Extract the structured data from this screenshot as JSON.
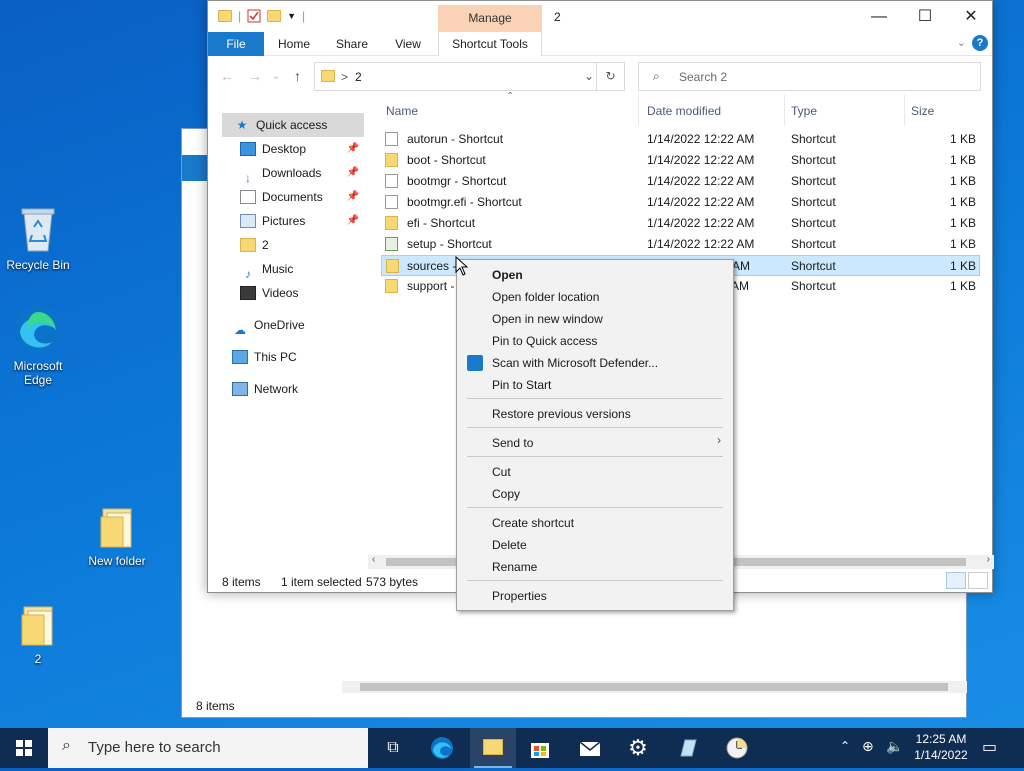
{
  "desktop": {
    "icons": [
      {
        "label": "Recycle Bin",
        "icon": "recycle-bin-icon"
      },
      {
        "label": "Microsoft Edge",
        "icon": "edge-icon"
      },
      {
        "label": "New folder",
        "icon": "folder-icon"
      },
      {
        "label": "2",
        "icon": "folder-icon"
      }
    ]
  },
  "background_window": {
    "status": "8 items"
  },
  "window": {
    "title": "2",
    "manage_tab": "Manage",
    "ribbon_tabs": [
      "File",
      "Home",
      "Share",
      "View",
      "Shortcut Tools"
    ],
    "address": {
      "separator": ">",
      "path": "2"
    },
    "search_placeholder": "Search 2",
    "controls": {
      "minimize": "—",
      "maximize": "☐",
      "close": "✕"
    },
    "help": "?"
  },
  "nav_pane": {
    "items": [
      {
        "label": "Quick access",
        "icon": "star-icon",
        "pinned": false
      },
      {
        "label": "Desktop",
        "icon": "desktop-icon",
        "pinned": true
      },
      {
        "label": "Downloads",
        "icon": "download-icon",
        "pinned": true
      },
      {
        "label": "Documents",
        "icon": "documents-icon",
        "pinned": true
      },
      {
        "label": "Pictures",
        "icon": "pictures-icon",
        "pinned": true
      },
      {
        "label": "2",
        "icon": "folder-icon",
        "pinned": false
      },
      {
        "label": "Music",
        "icon": "music-icon",
        "pinned": false
      },
      {
        "label": "Videos",
        "icon": "videos-icon",
        "pinned": false
      },
      {
        "label": "OneDrive",
        "icon": "cloud-icon",
        "pinned": false
      },
      {
        "label": "This PC",
        "icon": "computer-icon",
        "pinned": false
      },
      {
        "label": "Network",
        "icon": "network-icon",
        "pinned": false
      }
    ]
  },
  "file_list": {
    "columns": [
      "Name",
      "Date modified",
      "Type",
      "Size"
    ],
    "rows": [
      {
        "name": "autorun - Shortcut",
        "date": "1/14/2022 12:22 AM",
        "type": "Shortcut",
        "size": "1 KB"
      },
      {
        "name": "boot - Shortcut",
        "date": "1/14/2022 12:22 AM",
        "type": "Shortcut",
        "size": "1 KB"
      },
      {
        "name": "bootmgr - Shortcut",
        "date": "1/14/2022 12:22 AM",
        "type": "Shortcut",
        "size": "1 KB"
      },
      {
        "name": "bootmgr.efi - Shortcut",
        "date": "1/14/2022 12:22 AM",
        "type": "Shortcut",
        "size": "1 KB"
      },
      {
        "name": "efi - Shortcut",
        "date": "1/14/2022 12:22 AM",
        "type": "Shortcut",
        "size": "1 KB"
      },
      {
        "name": "setup - Shortcut",
        "date": "1/14/2022 12:22 AM",
        "type": "Shortcut",
        "size": "1 KB"
      },
      {
        "name": "sources -",
        "date": "AM",
        "type": "Shortcut",
        "size": "1 KB"
      },
      {
        "name": "support -",
        "date": "AM",
        "type": "Shortcut",
        "size": "1 KB"
      }
    ]
  },
  "status": {
    "count": "8 items",
    "selected": "1 item selected",
    "size": "573 bytes"
  },
  "context_menu": {
    "items": [
      "Open",
      "Open folder location",
      "Open in new window",
      "Pin to Quick access",
      "Scan with Microsoft Defender...",
      "Pin to Start",
      "Restore previous versions",
      "Send to",
      "Cut",
      "Copy",
      "Create shortcut",
      "Delete",
      "Rename",
      "Properties"
    ]
  },
  "taskbar": {
    "search_placeholder": "Type here to search",
    "time": "12:25 AM",
    "date": "1/14/2022"
  },
  "colors": {
    "accent": "#1979ca",
    "selection": "#cce8ff",
    "manage_tab": "#fad3b6",
    "taskbar": "#0f2c52"
  }
}
